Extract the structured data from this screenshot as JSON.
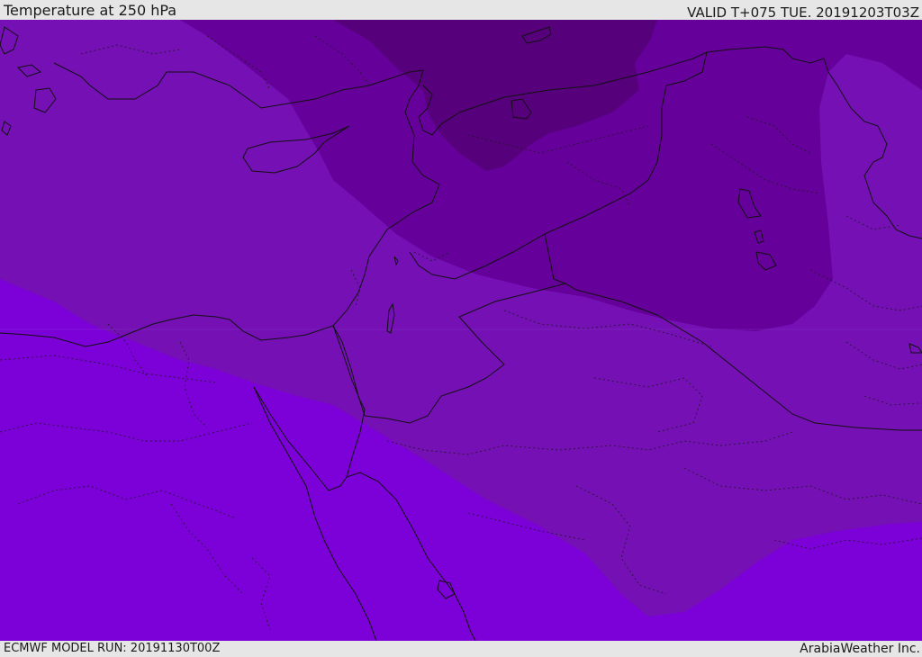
{
  "header": {
    "title": "Temperature at 250 hPa",
    "valid": "VALID T+075 TUE. 20191203T03Z"
  },
  "footer": {
    "model_run": "ECMWF MODEL RUN: 20191130T00Z",
    "credit": "ArabiaWeather Inc."
  },
  "colors": {
    "band_warm": "#7c00d8",
    "band_mid": "#7410b4",
    "band_cool": "#66009a",
    "band_cold": "#56007c",
    "coastline": "#111111"
  }
}
